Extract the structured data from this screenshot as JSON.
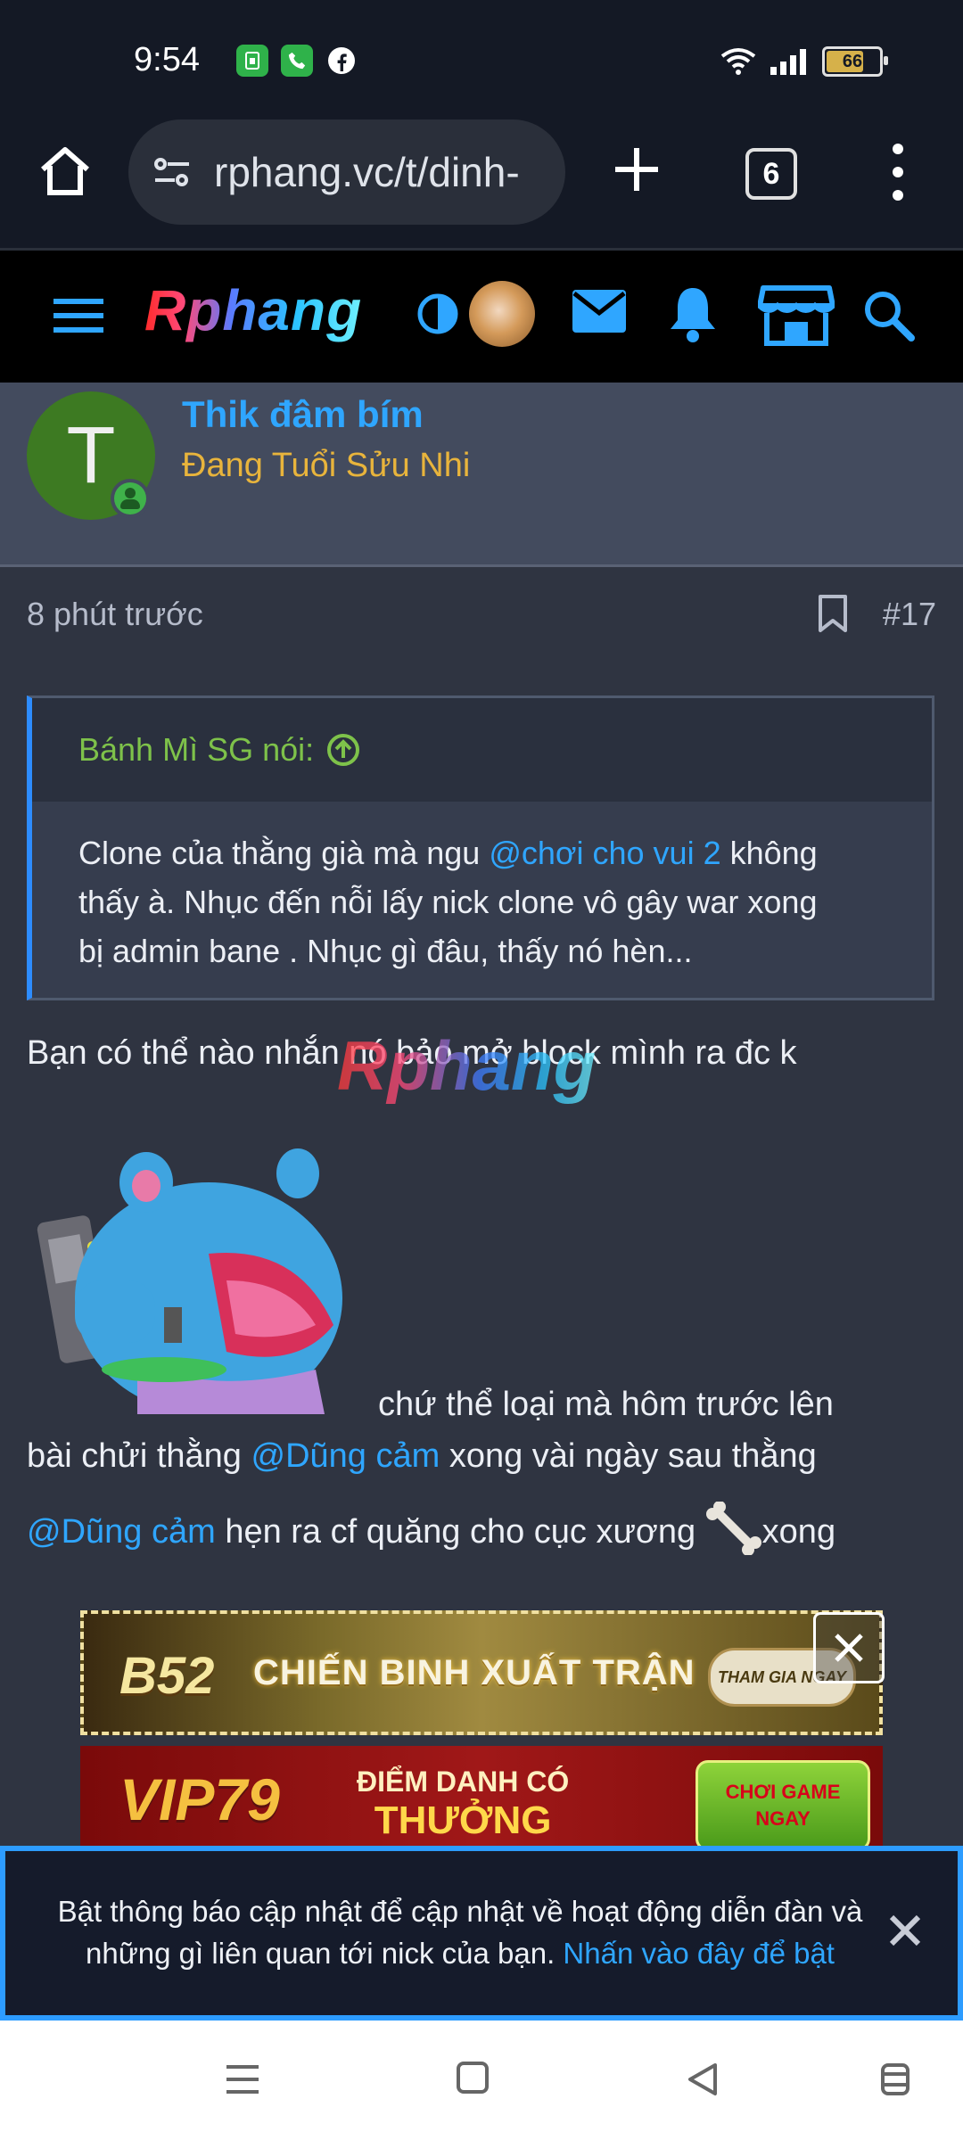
{
  "status_bar": {
    "time": "9:54",
    "battery": "66",
    "app_icons": [
      "sim-icon",
      "phone-icon",
      "facebook-icon"
    ]
  },
  "browser": {
    "url": "rphang.vc/t/dinh-",
    "tab_count": "6"
  },
  "site": {
    "logo": "Rphang"
  },
  "post": {
    "author": "Thik đâm bím",
    "author_title": "Đang Tuổi Sửu Nhi",
    "avatar_letter": "T",
    "time": "8 phút trước",
    "number": "#17",
    "quote": {
      "header": "Bánh Mì SG nói:",
      "line1_pre": "Clone của thằng già mà ngu ",
      "line1_mention": "@chơi cho vui 2",
      "line1_post": " không",
      "line2": "thấy à. Nhục đến nỗi lấy nick clone vô gây war xong",
      "line3": "bị admin bane . Nhục gì đâu, thấy nó hèn..."
    },
    "body_line1": "Bạn có thể nào nhắn nó bảo mở block mình ra đc k",
    "body_after_sticker": "chứ thể loại mà hôm trước lên",
    "body_line3_pre": "bài chửi thằng ",
    "mention1": "@Dũng cảm",
    "body_line3_post": " xong vài ngày sau thằng",
    "mention2": "@Dũng cảm",
    "body_line4_mid": " hẹn ra cf quăng cho cục xương ",
    "body_line4_end": "xong",
    "watermark": "Rphang"
  },
  "ads": {
    "ad1_logo": "B52",
    "ad1_text": "CHIẾN BINH XUẤT TRẬN",
    "ad1_button": "THAM GIA NGAY",
    "ad2_logo": "VIP79",
    "ad2_line1": "ĐIỂM DANH CÓ",
    "ad2_line2": "THƯỞNG",
    "ad2_button": "CHƠI GAME NGAY"
  },
  "notification": {
    "text": "Bật thông báo cập nhật để cập nhật về hoạt động diễn đàn và những gì liên quan tới nick của bạn. ",
    "link": "Nhấn vào đây để bật"
  },
  "colors": {
    "accent": "#2fa6ff",
    "quote_author": "#7ec24a",
    "user_title": "#e8b43c",
    "background": "#2f3441"
  }
}
